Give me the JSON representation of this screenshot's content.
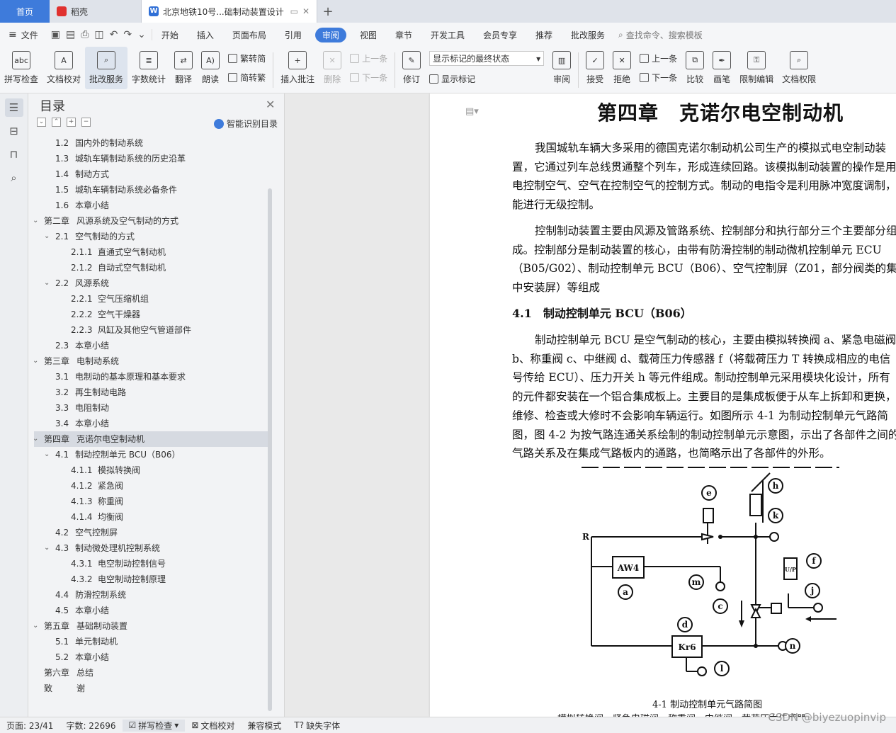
{
  "tabs": {
    "home": "首页",
    "daoke": "稻壳",
    "doc_title": "北京地铁10号...础制动装置设计",
    "add": "+"
  },
  "menu": {
    "file": "文件",
    "items": [
      "开始",
      "插入",
      "页面布局",
      "引用",
      "审阅",
      "视图",
      "章节",
      "开发工具",
      "会员专享",
      "推荐",
      "批改服务"
    ],
    "active_index": 4,
    "search": "查找命令、搜索模板"
  },
  "ribbon": {
    "spell": "拼写检查",
    "doc_check": "文档校对",
    "correct_service": "批改服务",
    "word_count": "字数统计",
    "translate": "翻译",
    "read_aloud": "朗读",
    "to_traditional": "繁转简",
    "to_simplified": "简转繁",
    "insert_comment": "插入批注",
    "delete": "删除",
    "prev": "上一条",
    "next": "下一条",
    "track": "修订",
    "markup_select": "显示标记的最终状态",
    "show_markup": "显示标记",
    "review": "审阅",
    "accept": "接受",
    "reject": "拒绝",
    "prev2": "上一条",
    "next2": "下一条",
    "compare": "比较",
    "pen": "画笔",
    "restrict_edit": "限制编辑",
    "doc_rights": "文档权限"
  },
  "toc": {
    "title": "目录",
    "smart": "智能识别目录",
    "items": [
      {
        "num": "1.2",
        "text": "国内外的制动系统",
        "level": 2
      },
      {
        "num": "1.3",
        "text": "城轨车辆制动系统的历史沿革",
        "level": 2
      },
      {
        "num": "1.4",
        "text": "制动方式",
        "level": 2
      },
      {
        "num": "1.5",
        "text": "城轨车辆制动系统必备条件",
        "level": 2
      },
      {
        "num": "1.6",
        "text": "本章小结",
        "level": 2
      },
      {
        "num": "第二章",
        "text": "风源系统及空气制动的方式",
        "level": 1,
        "chev": true
      },
      {
        "num": "2.1",
        "text": "空气制动的方式",
        "level": 2,
        "chev": true
      },
      {
        "num": "2.1.1",
        "text": "直通式空气制动机",
        "level": 3
      },
      {
        "num": "2.1.2",
        "text": "自动式空气制动机",
        "level": 3
      },
      {
        "num": "2.2",
        "text": "风源系统",
        "level": 2,
        "chev": true
      },
      {
        "num": "2.2.1",
        "text": "空气压缩机组",
        "level": 3
      },
      {
        "num": "2.2.2",
        "text": "空气干燥器",
        "level": 3
      },
      {
        "num": "2.2.3",
        "text": "风缸及其他空气管道部件",
        "level": 3
      },
      {
        "num": "2.3",
        "text": "本章小结",
        "level": 2
      },
      {
        "num": "第三章",
        "text": "电制动系统",
        "level": 1,
        "chev": true
      },
      {
        "num": "3.1",
        "text": "电制动的基本原理和基本要求",
        "level": 2
      },
      {
        "num": "3.2",
        "text": "再生制动电路",
        "level": 2
      },
      {
        "num": "3.3",
        "text": "电阻制动",
        "level": 2
      },
      {
        "num": "3.4",
        "text": "本章小结",
        "level": 2
      },
      {
        "num": "第四章",
        "text": "克诺尔电空制动机",
        "level": 1,
        "chev": true,
        "active": true
      },
      {
        "num": "4.1",
        "text": "制动控制单元 BCU（B06）",
        "level": 2,
        "chev": true
      },
      {
        "num": "4.1.1",
        "text": "模拟转换阀",
        "level": 3
      },
      {
        "num": "4.1.2",
        "text": "紧急阀",
        "level": 3
      },
      {
        "num": "4.1.3",
        "text": "称重阀",
        "level": 3
      },
      {
        "num": "4.1.4",
        "text": "均衡阀",
        "level": 3
      },
      {
        "num": "4.2",
        "text": "空气控制屏",
        "level": 2
      },
      {
        "num": "4.3",
        "text": "制动微处理机控制系统",
        "level": 2,
        "chev": true
      },
      {
        "num": "4.3.1",
        "text": "电空制动控制信号",
        "level": 3
      },
      {
        "num": "4.3.2",
        "text": "电空制动控制原理",
        "level": 3
      },
      {
        "num": "4.4",
        "text": "防滑控制系统",
        "level": 2
      },
      {
        "num": "4.5",
        "text": "本章小结",
        "level": 2
      },
      {
        "num": "第五章",
        "text": "基础制动装置",
        "level": 1,
        "chev": true
      },
      {
        "num": "5.1",
        "text": "单元制动机",
        "level": 2
      },
      {
        "num": "5.2",
        "text": "本章小结",
        "level": 2
      },
      {
        "num": "第六章",
        "text": "总结",
        "level": 1
      },
      {
        "num": "致",
        "text": "谢",
        "level": 1
      }
    ]
  },
  "document": {
    "chapter_title": "第四章　克诺尔电空制动机",
    "para1": "我国城轨车辆大多采用的德国克诺尔制动机公司生产的模拟式电空制动装置，它通过列车总线贯通整个列车，形成连续回路。该模拟制动装置的操作是用电控制空气、空气在控制空气的控制方式。制动的电指令是利用脉冲宽度调制，能进行无级控制。",
    "para2": "控制制动装置主要由风源及管路系统、控制部分和执行部分三个主要部分组成。控制部分是制动装置的核心，由带有防滑控制的制动微机控制单元 ECU（B05/G02）、制动控制单元 BCU（B06）、空气控制屏（Z01，部分阀类的集中安装屏）等组成",
    "section": "4.1　制动控制单元 BCU（B06）",
    "para3": "制动控制单元 BCU 是空气制动的核心，主要由模拟转换阀 a、紧急电磁阀 b、称重阀 c、中继阀 d、载荷压力传感器 f（将载荷压力 T 转换成相应的电信号传给 ECU）、压力开关 h 等元件组成。制动控制单元采用模块化设计，所有的元件都安装在一个铝合集成板上。主要目的是集成板便于从车上拆卸和更换，维修、检查或大修时不会影响车辆运行。如图所示 4-1 为制动控制单元气路简图，图 4-2 为按气路连通关系绘制的制动控制单元示意图，示出了各部件之间的气路关系及在集成气路板内的通路，也简略示出了各部件的外形。",
    "figure": {
      "labels": {
        "r": "R",
        "aw4": "AW4",
        "a": "a",
        "m": "m",
        "c": "c",
        "e": "e",
        "h": "h",
        "k": "k",
        "f": "f",
        "up": "U/P",
        "j": "j",
        "d": "d",
        "kr6": "Kr6",
        "n": "n",
        "l": "l"
      },
      "caption": "4-1  制动控制单元气路简图",
      "cut_text": "模拟转换阀　紧急电磁阀　称重阀　中继阀　载荷压力传感器"
    }
  },
  "status": {
    "page": "页面: 23/41",
    "words": "字数: 22696",
    "spell": "拼写检查",
    "doc_check": "文档校对",
    "compat": "兼容模式",
    "missing_font": "缺失字体"
  },
  "watermark": "CSDN @biyezuopinvip"
}
